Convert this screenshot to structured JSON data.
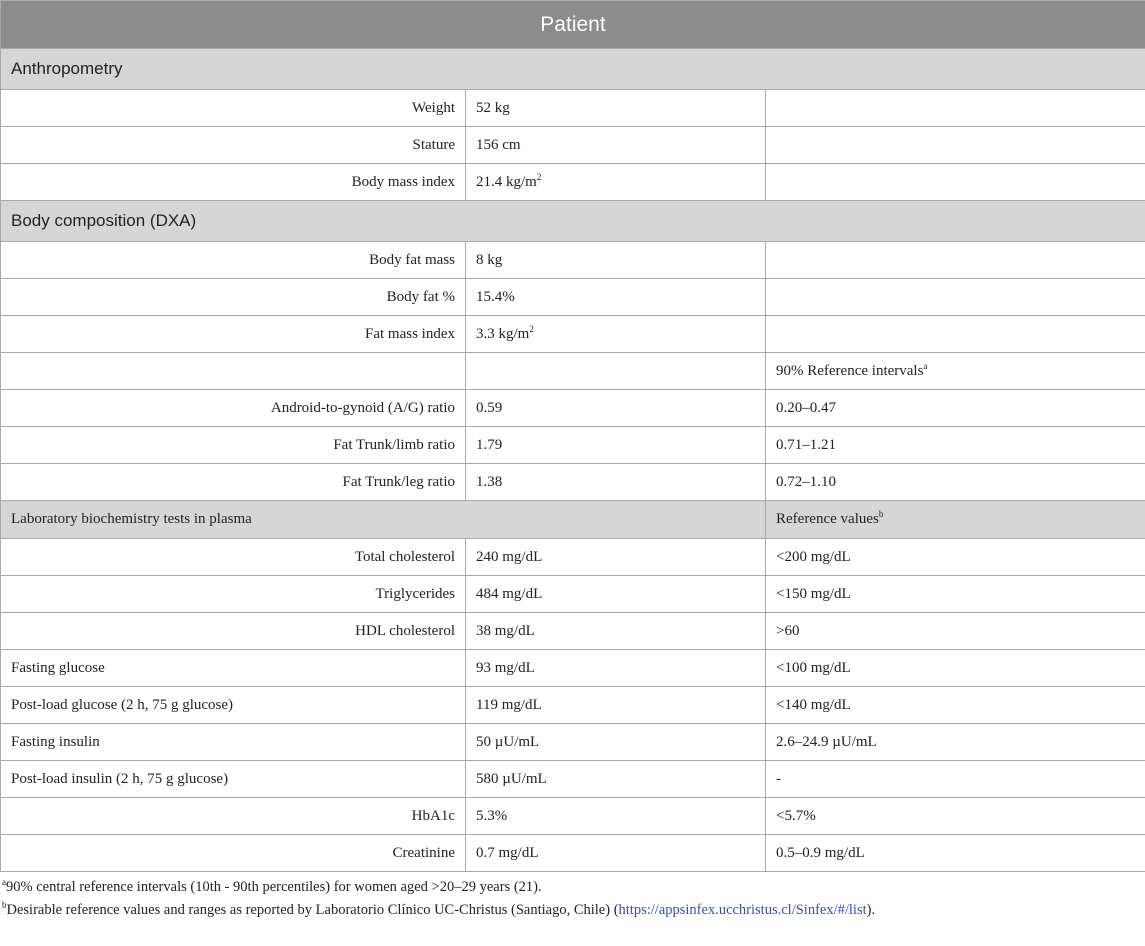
{
  "title": "Patient",
  "sections": {
    "anthropometry": "Anthropometry",
    "body_composition": "Body composition (DXA)",
    "lab": "Laboratory biochemistry tests in plasma"
  },
  "headers": {
    "ref_intervals": "90% Reference intervals",
    "ref_intervals_mark": "a",
    "ref_values": "Reference values",
    "ref_values_mark": "b"
  },
  "anthropometry_rows": [
    {
      "label": "Weight",
      "value": "52 kg",
      "ref": ""
    },
    {
      "label": "Stature",
      "value": "156 cm",
      "ref": ""
    },
    {
      "label": "Body mass index",
      "value": "21.4 kg/m",
      "unit_sup": "2",
      "ref": ""
    }
  ],
  "body_rows": [
    {
      "label": "Body fat mass",
      "value": "8 kg",
      "ref": ""
    },
    {
      "label": "Body fat %",
      "value": "15.4%",
      "ref": ""
    },
    {
      "label": "Fat mass index",
      "value": "3.3 kg/m",
      "unit_sup": "2",
      "ref": ""
    }
  ],
  "ratio_rows": [
    {
      "label": "Android-to-gynoid (A/G) ratio",
      "value": "0.59",
      "ref": "0.20–0.47"
    },
    {
      "label": "Fat Trunk/limb ratio",
      "value": "1.79",
      "ref": "0.71–1.21"
    },
    {
      "label": "Fat Trunk/leg ratio",
      "value": "1.38",
      "ref": "0.72–1.10"
    }
  ],
  "lab_rows": [
    {
      "label": "Total cholesterol",
      "value": "240 mg/dL",
      "ref": "<200 mg/dL",
      "align": "right"
    },
    {
      "label": "Triglycerides",
      "value": "484 mg/dL",
      "ref": "<150 mg/dL",
      "align": "right"
    },
    {
      "label": "HDL cholesterol",
      "value": "38 mg/dL",
      "ref": ">60",
      "align": "right"
    },
    {
      "label": "Fasting glucose",
      "value": "93 mg/dL",
      "ref": "<100 mg/dL",
      "align": "left"
    },
    {
      "label": "Post-load glucose (2 h, 75 g glucose)",
      "value": "119 mg/dL",
      "ref": "<140 mg/dL",
      "align": "left"
    },
    {
      "label": "Fasting insulin",
      "value": "50 µU/mL",
      "ref": "2.6–24.9 µU/mL",
      "align": "left"
    },
    {
      "label": "Post-load insulin (2 h, 75 g glucose)",
      "value": "580 µU/mL",
      "ref": "-",
      "align": "left"
    },
    {
      "label": "HbA1c",
      "value": "5.3%",
      "ref": "<5.7%",
      "align": "right"
    },
    {
      "label": "Creatinine",
      "value": "0.7 mg/dL",
      "ref": "0.5–0.9 mg/dL",
      "align": "right"
    }
  ],
  "footnotes": {
    "a_mark": "a",
    "a_text": "90% central reference intervals (10th - 90th percentiles) for women aged >20–29 years (21).",
    "b_mark": "b",
    "b_text_1": "Desirable reference values and ranges as reported by Laboratorio Clínico UC-Christus (Santiago, Chile) (",
    "b_link": "https://appsinfex.ucchristus.cl/Sinfex/#/list",
    "b_text_2": ")."
  }
}
